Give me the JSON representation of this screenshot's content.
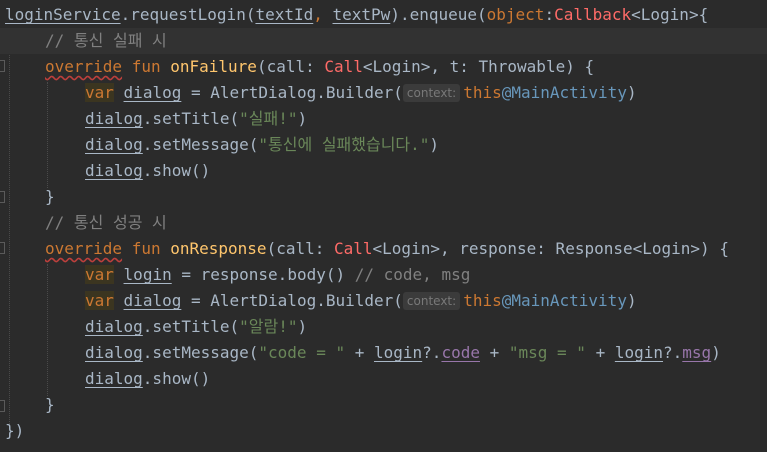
{
  "editor": {
    "language": "Kotlin",
    "background": "#2b2b2b",
    "keyword_color": "#cc7832",
    "string_color": "#6a8759",
    "comment_color": "#808080",
    "function_color": "#ffc66d",
    "property_color": "#9876aa"
  },
  "l1": {
    "a": "loginService",
    "b": ".requestLogin(",
    "c": "textId",
    "d": ", ",
    "e": "textPw",
    "f": ").enqueue(",
    "g": "object",
    "h": ":",
    "i": "Callback",
    "j": "<Login>{"
  },
  "l2": {
    "a": "// 통신 실패 시"
  },
  "l3": {
    "a": "override",
    "b": " fun ",
    "c": "onFailure",
    "d": "(call: ",
    "e": "Call",
    "f": "<Login>",
    "g": ", t: Throwable) {"
  },
  "l4": {
    "a": "var",
    "b": " ",
    "c": "dialog",
    "d": " = AlertDialog.Builder(",
    "hint": "context:",
    "e": "this",
    "f": "@MainActivity",
    "g": ")"
  },
  "l5": {
    "a": "dialog",
    "b": ".setTitle(",
    "c": "\"실패!\"",
    "d": ")"
  },
  "l6": {
    "a": "dialog",
    "b": ".setMessage(",
    "c": "\"통신에 실패했습니다.\"",
    "d": ")"
  },
  "l7": {
    "a": "dialog",
    "b": ".show()"
  },
  "l8": {
    "a": "}"
  },
  "l9": {
    "a": "// 통신 성공 시"
  },
  "l10": {
    "a": "override",
    "b": " fun ",
    "c": "onResponse",
    "d": "(call: ",
    "e": "Call",
    "f": "<Login>, response: Response<Login>) {"
  },
  "l11": {
    "a": "var",
    "b": " ",
    "c": "login",
    "d": " = response.body() ",
    "e": "// code, msg"
  },
  "l12": {
    "a": "var",
    "b": " ",
    "c": "dialog",
    "d": " = AlertDialog.Builder(",
    "hint": "context:",
    "e": "this",
    "f": "@MainActivity",
    "g": ")"
  },
  "l13": {
    "a": "dialog",
    "b": ".setTitle(",
    "c": "\"알람!\"",
    "d": ")"
  },
  "l14": {
    "a": "dialog",
    "b": ".setMessage(",
    "c": "\"code = \"",
    "d": " + ",
    "e": "login",
    "f": "?.",
    "g": "code",
    "h": " + ",
    "i": "\"msg = \"",
    "j": " + ",
    "k": "login",
    "l": "?.",
    "m": "msg",
    "n": ")"
  },
  "l15": {
    "a": "dialog",
    "b": ".show()"
  },
  "l16": {
    "a": "}"
  },
  "l17": {
    "a": "})"
  }
}
